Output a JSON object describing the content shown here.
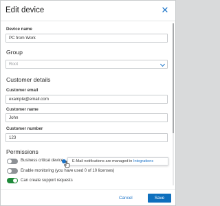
{
  "dialog": {
    "title": "Edit device",
    "close_icon": "close-icon"
  },
  "device_name": {
    "label": "Device name",
    "value": "PC from Work"
  },
  "group": {
    "section": "Group",
    "selected": "Root"
  },
  "customer": {
    "section": "Customer details",
    "email_label": "Customer email",
    "email_value": "example@email.com",
    "name_label": "Customer name",
    "name_value": "John",
    "number_label": "Customer number",
    "number_value": "123"
  },
  "permissions": {
    "section": "Permissions",
    "business_critical": {
      "label": "Business critical device",
      "on": false
    },
    "monitoring": {
      "label": "Enable monitoring (you have used 0 of 10 licenses)",
      "on": false
    },
    "support": {
      "label": "Can create support requests",
      "on": true
    }
  },
  "tooltip": {
    "text": "E-Mail notifications are managed in ",
    "link": "Integrations"
  },
  "footer": {
    "cancel_label": "Cancel",
    "save_label": "Save"
  },
  "colors": {
    "accent": "#1a73c8",
    "save_bg": "#0e6fbd",
    "toggle_on": "#1f8a3a",
    "toggle_off": "#8e9296"
  }
}
